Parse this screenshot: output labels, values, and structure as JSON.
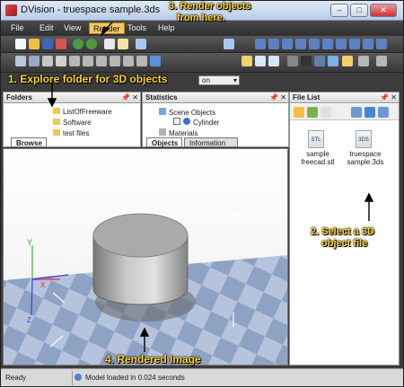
{
  "window": {
    "title": "DVision - truespace sample.3ds",
    "controls": [
      "–",
      "□",
      "✕"
    ]
  },
  "menu": {
    "items": [
      "File",
      "Edit",
      "View",
      "Render",
      "Tools",
      "Help"
    ],
    "active": "Render"
  },
  "toolbar": {
    "combo_value": "on"
  },
  "panels": {
    "folders": {
      "title": "Folders",
      "tree": [
        "ListOfFreeware",
        "Software",
        "test files"
      ],
      "tabs": [
        "Browse"
      ]
    },
    "statistics": {
      "title": "Statistics",
      "tree": [
        "Scene Objects",
        "Cylinder",
        "Materials"
      ],
      "tabs": [
        "Objects",
        "Information"
      ]
    },
    "file_list": {
      "title": "File List",
      "files": [
        {
          "badge": "STL",
          "name": "sample freecad.stl"
        },
        {
          "badge": "3DS",
          "name": "truespace sample.3ds"
        }
      ]
    }
  },
  "annotations": {
    "explore": "1. Explore folder for 3D objects",
    "select_line1": "2. Select a 3D",
    "select_line2": "object file",
    "render_line1": "3. Render objects",
    "render_line2": "from here.",
    "rendered": "4. Rendered Image"
  },
  "axes": {
    "x": "X",
    "y": "Y",
    "z": "Z"
  },
  "status": {
    "left": "Ready",
    "message": "Model loaded in 0.024 seconds"
  },
  "colors": {
    "annotation": "#ffd32a",
    "active_menu": "#f4c866",
    "background_panel": "#3c3c3c"
  }
}
